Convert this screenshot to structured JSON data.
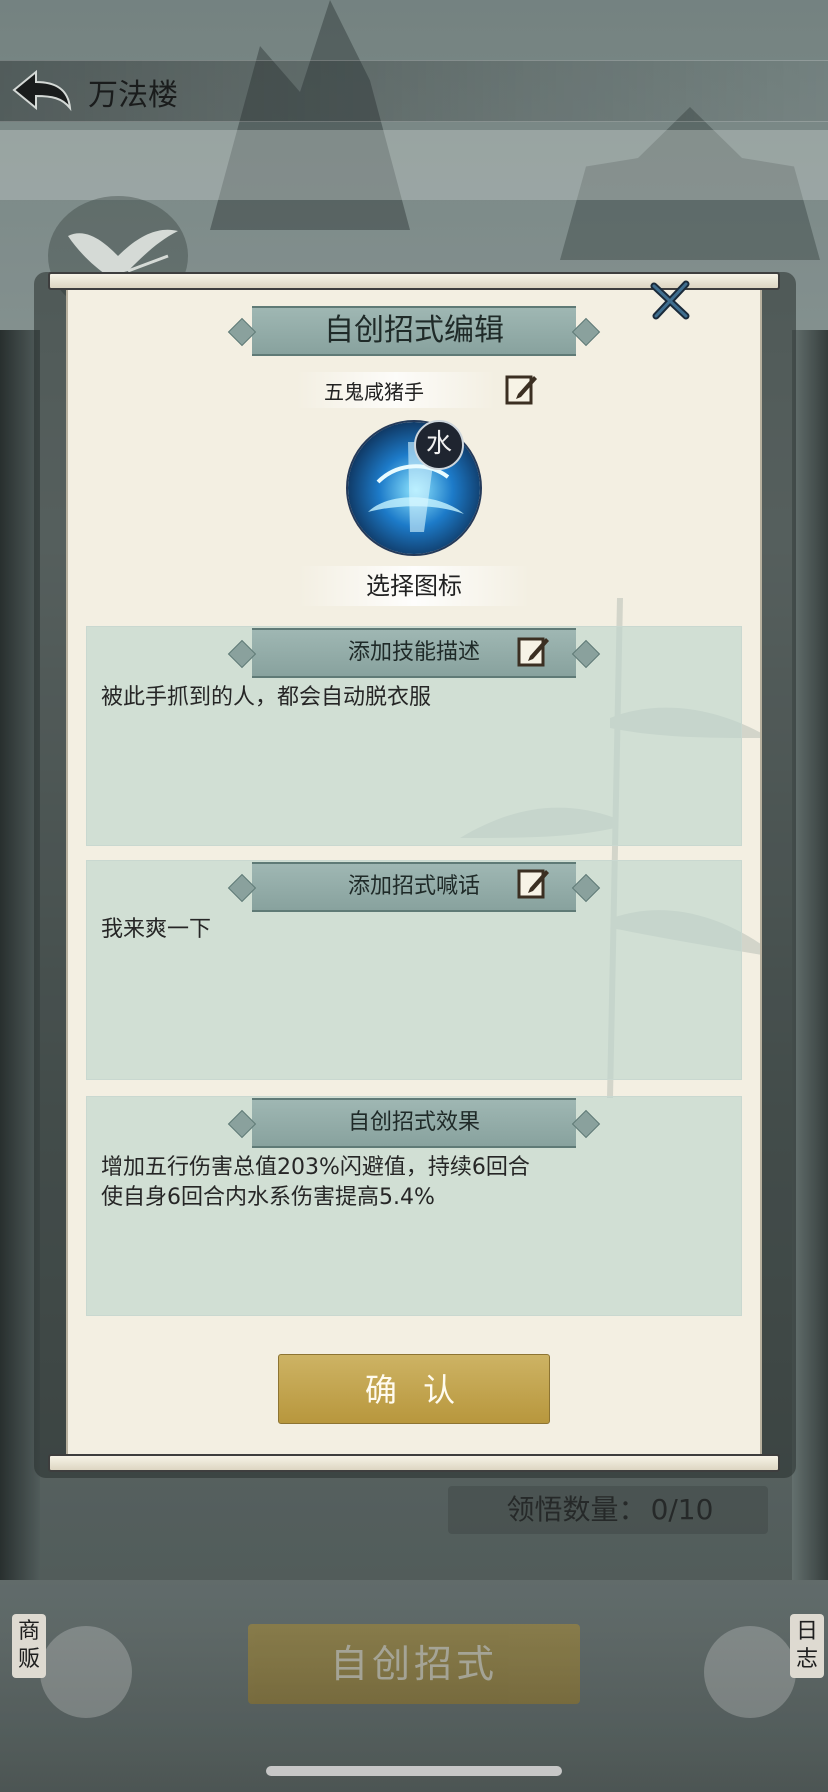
{
  "header": {
    "title": "万法楼"
  },
  "modal": {
    "title": "自创招式编辑",
    "skill_name": "五鬼咸猪手",
    "element_badge": "水",
    "choose_icon_label": "选择图标",
    "description": {
      "label": "添加技能描述",
      "text": "被此手抓到的人，都会自动脱衣服"
    },
    "shout": {
      "label": "添加招式喊话",
      "text": "我来爽一下"
    },
    "effect": {
      "label": "自创招式效果",
      "lines": "增加五行伤害总值203%闪避值，持续6回合\n使自身6回合内水系伤害提高5.4%"
    },
    "confirm_label": "确 认"
  },
  "footer": {
    "comprehend_label": "领悟数量：",
    "comprehend_value": "0/10",
    "create_label": "自创招式",
    "vendor_label": "商\n贩",
    "log_label": "日\n志"
  },
  "colors": {
    "ribbon": "#88a29e",
    "panel": "#bed6cc",
    "paper": "#f3efe2",
    "confirm": "#b8973d"
  }
}
